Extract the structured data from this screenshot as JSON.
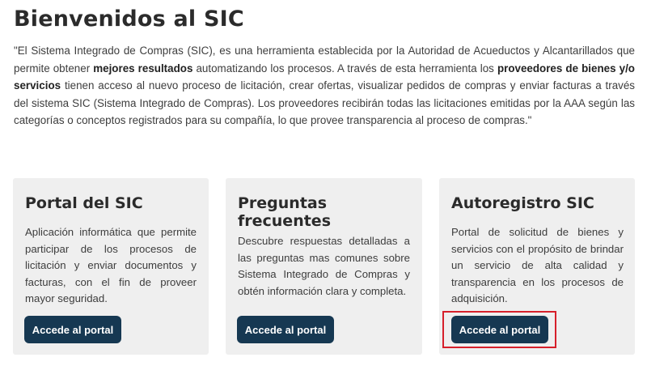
{
  "page": {
    "title": "Bienvenidos al SIC",
    "intro": {
      "p1": "\"El Sistema Integrado de Compras (SIC), es una herramienta establecida por la Autoridad de Acueductos y Alcantarillados que permite obtener ",
      "b1": "mejores resultados",
      "p2": " automatizando los procesos. A través de esta herramienta los ",
      "b2": "proveedores de bienes y/o servicios",
      "p3": " tienen acceso al nuevo proceso de licitación, crear ofertas, visualizar pedidos de compras y enviar facturas a través del sistema SIC (Sistema Integrado de Compras). Los proveedores recibirán todas las licitaciones emitidas por la AAA según las categorías o conceptos registrados para su compañía, lo que provee transparencia al proceso de compras.\""
    }
  },
  "cards": [
    {
      "title": "Portal del SIC",
      "text": "Aplicación informática que permite participar de los procesos de licitación y enviar documentos y facturas, con el fin de proveer mayor seguridad.",
      "button": "Accede al portal"
    },
    {
      "title": "Preguntas frecuentes",
      "text": "Descubre respuestas detalladas a las preguntas mas comunes sobre Sistema Integrado de Compras y obtén información clara y completa.",
      "button": "Accede al portal"
    },
    {
      "title": "Autoregistro SIC",
      "text": "Portal de solicitud de bienes y servicios con el propósito de brindar un servicio de alta calidad y transparencia en los procesos de adquisición.",
      "button": "Accede al portal"
    }
  ],
  "colors": {
    "button": "#163852",
    "card": "#efefef",
    "highlight": "#d6202b"
  }
}
